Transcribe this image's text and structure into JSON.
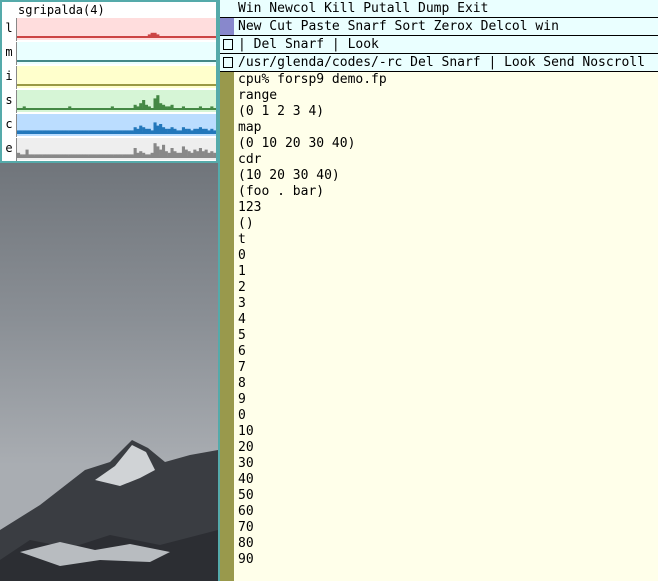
{
  "stats": {
    "title": "sgripalda(4)",
    "rows": [
      {
        "label": "l",
        "bg": "#ffdddd",
        "fg": "#cc4444",
        "peaks": [
          0,
          0,
          0,
          0,
          0,
          0,
          0,
          0,
          0,
          0,
          0,
          0,
          0,
          0,
          0,
          0,
          0,
          0,
          0,
          0,
          0,
          0,
          0,
          0,
          0,
          0,
          0,
          0,
          0,
          0,
          0,
          0,
          0,
          0,
          0,
          0,
          0,
          0,
          0,
          0,
          0,
          0,
          0,
          0,
          0,
          0,
          1,
          2,
          2,
          1,
          0,
          0,
          0,
          0,
          0,
          0,
          0,
          0,
          0,
          0,
          0,
          0,
          0,
          0,
          0,
          0,
          0,
          0,
          0,
          0
        ]
      },
      {
        "label": "m",
        "bg": "#eaffff",
        "fg": "#448888",
        "peaks": [
          0,
          0,
          0,
          0,
          0,
          0,
          0,
          0,
          0,
          0,
          0,
          0,
          0,
          0,
          0,
          0,
          0,
          0,
          0,
          0,
          0,
          0,
          0,
          0,
          0,
          0,
          0,
          0,
          0,
          0,
          0,
          0,
          0,
          0,
          0,
          0,
          0,
          0,
          0,
          0,
          0,
          0,
          0,
          0,
          0,
          0,
          0,
          0,
          0,
          0,
          0,
          0,
          0,
          0,
          0,
          0,
          0,
          0,
          0,
          0,
          0,
          0,
          0,
          0,
          0,
          0,
          0,
          0,
          0,
          0
        ]
      },
      {
        "label": "i",
        "bg": "#ffffcc",
        "fg": "#999944",
        "peaks": [
          0,
          0,
          0,
          0,
          0,
          0,
          0,
          0,
          0,
          0,
          0,
          0,
          0,
          0,
          0,
          0,
          0,
          0,
          0,
          0,
          0,
          0,
          0,
          0,
          0,
          0,
          0,
          0,
          0,
          0,
          0,
          0,
          0,
          0,
          0,
          0,
          0,
          0,
          0,
          0,
          0,
          0,
          0,
          0,
          0,
          0,
          0,
          0,
          0,
          0,
          0,
          0,
          0,
          0,
          0,
          0,
          0,
          0,
          0,
          0,
          0,
          0,
          0,
          0,
          0,
          0,
          0,
          0,
          0,
          0
        ]
      },
      {
        "label": "s",
        "bg": "#d6f5d6",
        "fg": "#448844",
        "peaks": [
          0,
          0,
          1,
          0,
          0,
          0,
          0,
          0,
          0,
          0,
          0,
          0,
          0,
          0,
          0,
          0,
          0,
          0,
          1,
          0,
          0,
          0,
          0,
          0,
          0,
          0,
          0,
          0,
          0,
          0,
          0,
          0,
          0,
          1,
          0,
          0,
          0,
          0,
          0,
          0,
          0,
          2,
          1,
          3,
          5,
          2,
          1,
          0,
          6,
          8,
          3,
          2,
          1,
          1,
          2,
          0,
          0,
          0,
          1,
          0,
          0,
          0,
          0,
          0,
          1,
          0,
          0,
          0,
          1,
          0
        ]
      },
      {
        "label": "c",
        "bg": "#bbddff",
        "fg": "#2277bb",
        "peaks": [
          1,
          1,
          1,
          1,
          1,
          1,
          1,
          1,
          1,
          1,
          1,
          1,
          1,
          1,
          1,
          1,
          1,
          1,
          1,
          1,
          1,
          1,
          1,
          1,
          1,
          1,
          1,
          1,
          1,
          1,
          1,
          1,
          1,
          1,
          1,
          1,
          1,
          1,
          1,
          1,
          1,
          3,
          2,
          4,
          3,
          2,
          2,
          1,
          6,
          4,
          5,
          3,
          2,
          2,
          3,
          2,
          1,
          1,
          3,
          2,
          2,
          1,
          2,
          2,
          3,
          2,
          2,
          1,
          2,
          1
        ]
      },
      {
        "label": "e",
        "bg": "#eeeeee",
        "fg": "#888888",
        "peaks": [
          2,
          1,
          1,
          4,
          1,
          1,
          1,
          1,
          1,
          1,
          1,
          1,
          1,
          1,
          1,
          1,
          1,
          1,
          1,
          1,
          1,
          1,
          1,
          1,
          1,
          1,
          1,
          1,
          1,
          1,
          1,
          1,
          1,
          1,
          1,
          1,
          1,
          1,
          1,
          1,
          1,
          5,
          2,
          3,
          2,
          1,
          1,
          2,
          8,
          6,
          4,
          7,
          3,
          2,
          5,
          3,
          2,
          2,
          6,
          4,
          3,
          2,
          4,
          3,
          5,
          3,
          4,
          2,
          3,
          2
        ]
      }
    ]
  },
  "acme": {
    "tag_main": "Win Newcol Kill Putall Dump Exit",
    "tag_column": "New Cut Paste Snarf Sort Zerox Delcol win",
    "tag_window1": "| Del Snarf | Look",
    "tag_window2": "/usr/glenda/codes/-rc Del Snarf | Look Send Noscroll",
    "lines": [
      "cpu% forsp9 demo.fp",
      "range",
      "(0 1 2 3 4)",
      "map",
      "(0 10 20 30 40)",
      "cdr",
      "(10 20 30 40)",
      "(foo . bar)",
      "123",
      "()",
      "t",
      "0",
      "1",
      "2",
      "3",
      "4",
      "5",
      "6",
      "7",
      "8",
      "9",
      "0",
      "10",
      "20",
      "30",
      "40",
      "50",
      "60",
      "70",
      "80",
      "90"
    ]
  }
}
